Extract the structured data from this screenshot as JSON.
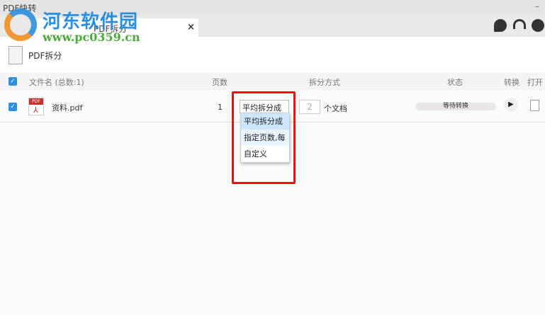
{
  "app": {
    "title": "PDF快转",
    "minimize": "–"
  },
  "tab": {
    "label": "PDF拆分",
    "close": "×"
  },
  "top_icons": [
    "chat-icon",
    "headset-icon",
    "user-icon"
  ],
  "toolbar": {
    "label": "PDF拆分"
  },
  "table": {
    "headers": {
      "filename": "文件名 (总数:1)",
      "pages": "页数",
      "method": "拆分方式",
      "status": "状态",
      "convert": "转换",
      "open": "打开"
    },
    "rows": [
      {
        "name": "资料.pdf",
        "pages": "1",
        "method": "平均拆分成",
        "count": "2",
        "count_unit": "个文档",
        "status": "等待转换"
      }
    ]
  },
  "dropdown": {
    "options": [
      "平均拆分成",
      "指定页数,每",
      "自定义"
    ],
    "selected": "平均拆分成"
  },
  "watermark": {
    "name": "河东软件园",
    "url": "www.pc0359.cn"
  },
  "colors": {
    "accent": "#2c8fe0",
    "highlight": "#f01010",
    "pdf": "#c9302c"
  }
}
